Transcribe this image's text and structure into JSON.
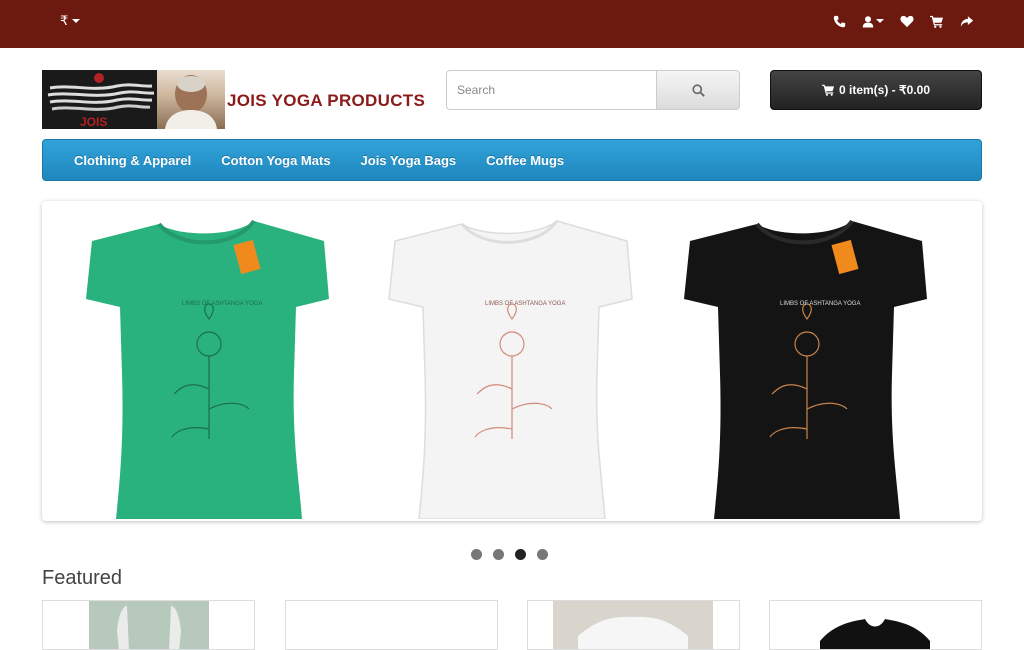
{
  "topbar": {
    "currency_symbol": "₹",
    "icons": [
      "phone-icon",
      "user-icon",
      "heart-icon",
      "cart-icon",
      "share-icon"
    ]
  },
  "header": {
    "logo_text": "JOIS",
    "brand_name": "JOIS YOGA PRODUCTS",
    "search_placeholder": "Search",
    "cart_label": "0 item(s) - ₹0.00"
  },
  "menu": {
    "items": [
      {
        "label": "Clothing & Apparel"
      },
      {
        "label": "Cotton Yoga Mats"
      },
      {
        "label": "Jois Yoga Bags"
      },
      {
        "label": "Coffee Mugs"
      }
    ]
  },
  "carousel": {
    "colors": {
      "green": "#2ab27e",
      "white": "#f4f4f4",
      "black": "#141414"
    },
    "dot_count": 4,
    "active_dot": 3
  },
  "featured": {
    "title": "Featured"
  },
  "colors": {
    "topbar": "#6c1a10",
    "menu": "#2594cb",
    "brand": "#8b1a1a",
    "cart_button": "#333333"
  }
}
